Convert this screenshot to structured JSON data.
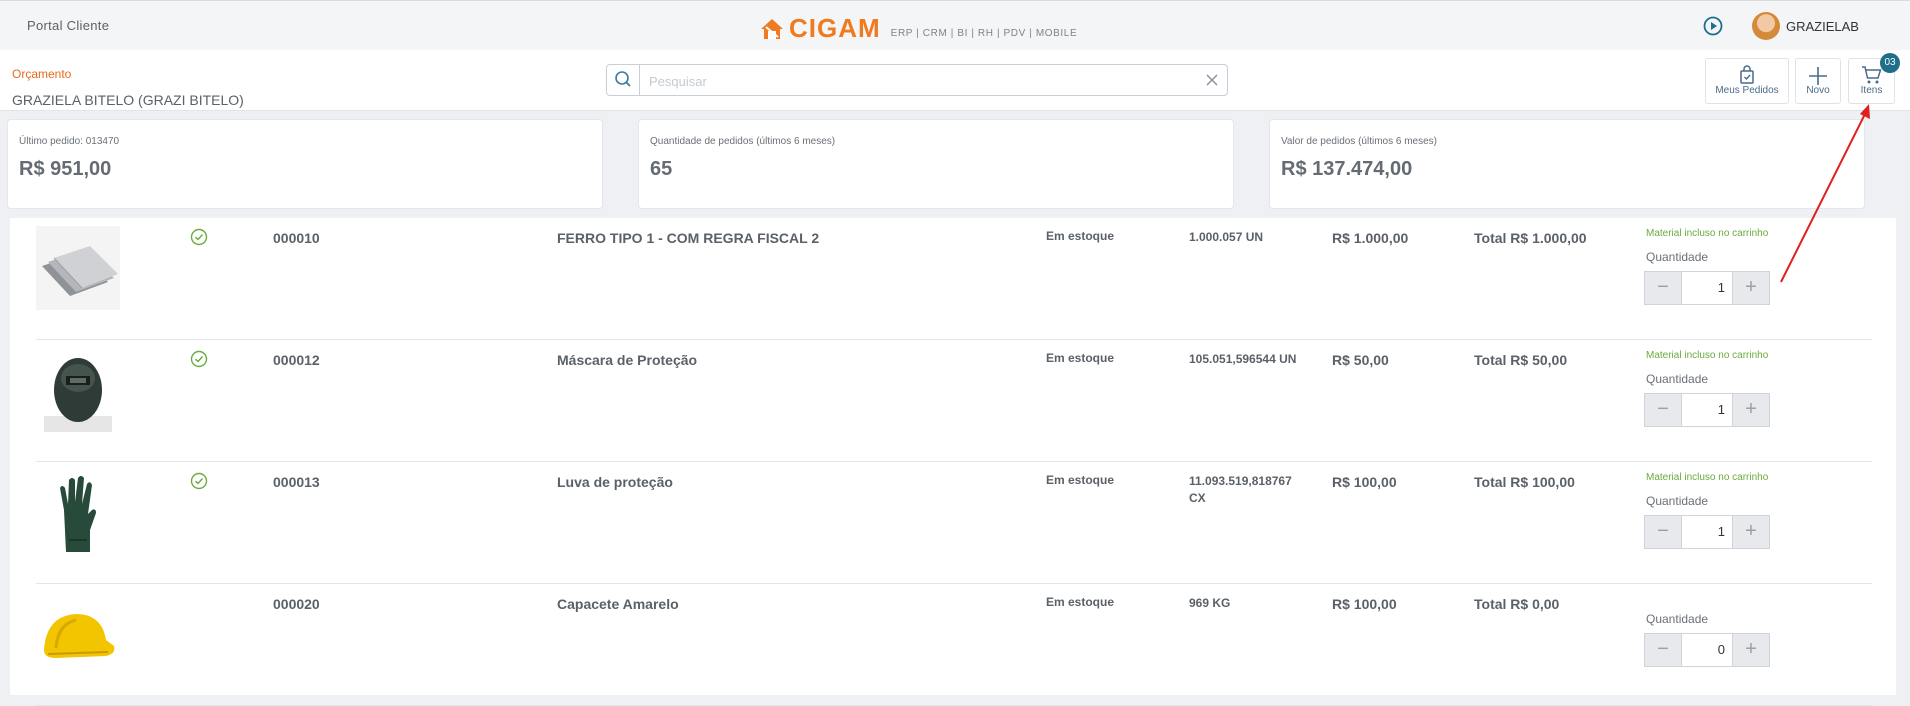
{
  "header": {
    "portal_title": "Portal Cliente",
    "logo_text": "CIGAM",
    "logo_subtitle": "ERP | CRM | BI | RH | PDV | MOBILE",
    "user_name": "GRAZIELAB"
  },
  "subheader": {
    "budget_label": "Orçamento",
    "client_name": "GRAZIELA BITELO (GRAZI BITELO)",
    "search_placeholder": "Pesquisar",
    "search_value": "",
    "buttons": {
      "orders": "Meus Pedidos",
      "new": "Novo",
      "items": "Itens",
      "items_badge": "03"
    }
  },
  "stats": [
    {
      "label": "Último pedido: 013470",
      "value": "R$ 951,00"
    },
    {
      "label": "Quantidade de pedidos (últimos 6 meses)",
      "value": "65"
    },
    {
      "label": "Valor de pedidos (últimos 6 meses)",
      "value": "R$ 137.474,00"
    }
  ],
  "products": [
    {
      "image": "steel-sheets",
      "in_cart": true,
      "code": "000010",
      "name": "FERRO TIPO 1 - COM REGRA FISCAL 2",
      "stock_status": "Em estoque",
      "available": "1.000.057 UN",
      "price": "R$ 1.000,00",
      "total": "Total R$ 1.000,00",
      "cart_note": "Material incluso no carrinho",
      "qty_label": "Quantidade",
      "qty": "1"
    },
    {
      "image": "welding-mask",
      "in_cart": true,
      "code": "000012",
      "name": "Máscara de Proteção",
      "stock_status": "Em estoque",
      "available": "105.051,596544 UN",
      "price": "R$ 50,00",
      "total": "Total R$ 50,00",
      "cart_note": "Material incluso no carrinho",
      "qty_label": "Quantidade",
      "qty": "1"
    },
    {
      "image": "glove",
      "in_cart": true,
      "code": "000013",
      "name": "Luva de proteção",
      "stock_status": "Em estoque",
      "available": "11.093.519,818767 CX",
      "price": "R$ 100,00",
      "total": "Total R$ 100,00",
      "cart_note": "Material incluso no carrinho",
      "qty_label": "Quantidade",
      "qty": "1"
    },
    {
      "image": "yellow-helmet",
      "in_cart": false,
      "code": "000020",
      "name": "Capacete Amarelo",
      "stock_status": "Em estoque",
      "available": "969 KG",
      "price": "R$ 100,00",
      "total": "Total R$ 0,00",
      "cart_note": "",
      "qty_label": "Quantidade",
      "qty": "0"
    }
  ],
  "stepper": {
    "minus": "−",
    "plus": "+"
  },
  "colors": {
    "accent": "#f07a1f",
    "badge": "#1f6e8c",
    "in_cart": "#6aab3d",
    "annotation_arrow": "#e02020"
  }
}
